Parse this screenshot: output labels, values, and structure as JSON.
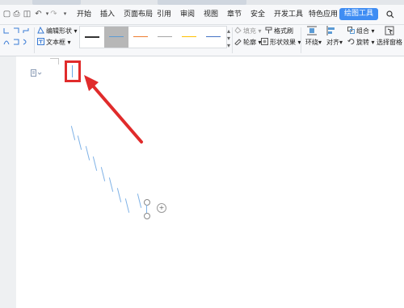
{
  "window": {
    "tab1": "...",
    "tab2": "..."
  },
  "menubar": {
    "items": [
      "开始",
      "插入",
      "页面布局",
      "引用",
      "审阅",
      "视图",
      "章节",
      "安全",
      "开发工具",
      "特色应用"
    ],
    "active": "绘图工具",
    "search_icon": "search-icon",
    "quick_icons": [
      "file-icon",
      "print-icon",
      "preview-icon",
      "undo-icon",
      "redo-icon"
    ]
  },
  "ribbon": {
    "edit_shape": "编辑形状",
    "text_box": "文本框",
    "fill": "填充",
    "format_painter": "格式刷",
    "outline": "轮廓",
    "shape_effect": "形状效果",
    "wrap": "环绕",
    "align": "对齐",
    "group": "组合",
    "rotate": "旋转",
    "selection_pane": "选择窗格",
    "line_styles": [
      {
        "color": "#333333",
        "selected": false
      },
      {
        "color": "#5b9bd5",
        "selected": true
      },
      {
        "color": "#ed7d31",
        "selected": false
      },
      {
        "color": "#a5a5a5",
        "selected": false
      },
      {
        "color": "#ffc000",
        "selected": false
      },
      {
        "color": "#4472c4",
        "selected": false
      }
    ]
  },
  "document": {
    "highlight_color": "#e02b2b",
    "line_color": "#7fb2e6"
  }
}
